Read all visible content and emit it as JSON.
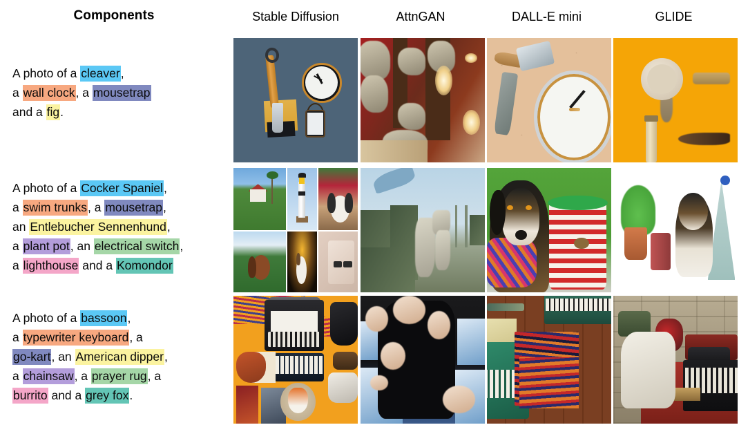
{
  "header": {
    "components_label": "Components",
    "models": [
      "Stable Diffusion",
      "AttnGAN",
      "DALL-E mini",
      "GLIDE"
    ]
  },
  "highlight_colors": {
    "cyan": "#5bc8f5",
    "orange": "#f7a880",
    "blue_violet": "#8089bf",
    "yellow": "#fbf3a0",
    "purple": "#b39ddb",
    "green": "#a5d6a7",
    "pink": "#f4a6c8",
    "teal": "#63c5b5"
  },
  "rows": [
    {
      "prompt_segments": [
        {
          "text": "A photo of a ",
          "color": null
        },
        {
          "text": "cleaver",
          "color": "#5bc8f5"
        },
        {
          "text": ",\n",
          "color": null
        },
        {
          "text": "a ",
          "color": null
        },
        {
          "text": "wall clock",
          "color": "#f7a880"
        },
        {
          "text": ", a ",
          "color": null
        },
        {
          "text": "mousetrap",
          "color": "#8089bf"
        },
        {
          "text": "\nand a ",
          "color": null
        },
        {
          "text": "fig",
          "color": "#fbf3a0"
        },
        {
          "text": ".",
          "color": null
        }
      ],
      "prompt_plain": "A photo of a cleaver, a wall clock, a mousetrap and a fig.",
      "components": [
        "cleaver",
        "wall clock",
        "mousetrap",
        "fig"
      ],
      "images": [
        {
          "model": "Stable Diffusion",
          "description": "cleaver, wall clock and mousetrap arranged on a slate blue background"
        },
        {
          "model": "AttnGAN",
          "description": "distorted beige objects against a red and brown wooden wall"
        },
        {
          "model": "DALL-E mini",
          "description": "two cleavers beside a large wall clock on a speckled beige surface"
        },
        {
          "model": "GLIDE",
          "description": "wall clock and blurred objects on a bright orange wall"
        }
      ]
    },
    {
      "prompt_segments": [
        {
          "text": "A photo of a ",
          "color": null
        },
        {
          "text": "Cocker Spaniel",
          "color": "#5bc8f5"
        },
        {
          "text": ",\n",
          "color": null
        },
        {
          "text": "a ",
          "color": null
        },
        {
          "text": "swim trunks",
          "color": "#f7a880"
        },
        {
          "text": ", a ",
          "color": null
        },
        {
          "text": "mousetrap",
          "color": "#8089bf"
        },
        {
          "text": ",\nan ",
          "color": null
        },
        {
          "text": "Entlebucher Sennenhund",
          "color": "#fbf3a0"
        },
        {
          "text": ",\na ",
          "color": null
        },
        {
          "text": "plant pot",
          "color": "#b39ddb"
        },
        {
          "text": ", an ",
          "color": null
        },
        {
          "text": "electrical switch",
          "color": "#a5d6a7"
        },
        {
          "text": ",\na ",
          "color": null
        },
        {
          "text": "lighthouse",
          "color": "#f4a6c8"
        },
        {
          "text": " and a ",
          "color": null
        },
        {
          "text": "Komondor",
          "color": "#63c5b5"
        }
      ],
      "prompt_plain": "A photo of a Cocker Spaniel, a swim trunks, a mousetrap, an Entlebucher Sennenhund, a plant pot, an electrical switch, a lighthouse and a Komondor",
      "components": [
        "Cocker Spaniel",
        "swim trunks",
        "mousetrap",
        "Entlebucher Sennenhund",
        "plant pot",
        "electrical switch",
        "lighthouse",
        "Komondor"
      ],
      "images": [
        {
          "model": "Stable Diffusion",
          "description": "collage of six photos: house with garden, lighthouse, shaggy dog with red flowers, hound at the beach, dog under a spotlight, and a wall light switch"
        },
        {
          "model": "AttnGAN",
          "description": "washed out green structures and pale figures under a blue sky"
        },
        {
          "model": "DALL-E mini",
          "description": "black and tan dog wearing a patterned coat next to a red and white striped pot on grass"
        },
        {
          "model": "GLIDE",
          "description": "plant in a terracotta pot, a red cylinder and a tricolour dog on white"
        }
      ]
    },
    {
      "prompt_segments": [
        {
          "text": "A photo of a ",
          "color": null
        },
        {
          "text": "bassoon",
          "color": "#5bc8f5"
        },
        {
          "text": ",\n",
          "color": null
        },
        {
          "text": "a ",
          "color": null
        },
        {
          "text": "typewriter keyboard",
          "color": "#f7a880"
        },
        {
          "text": ", a\n",
          "color": null
        },
        {
          "text": "go-kart",
          "color": "#8089bf"
        },
        {
          "text": ", an ",
          "color": null
        },
        {
          "text": "American dipper",
          "color": "#fbf3a0"
        },
        {
          "text": ",\na ",
          "color": null
        },
        {
          "text": "chainsaw",
          "color": "#b39ddb"
        },
        {
          "text": ", a ",
          "color": null
        },
        {
          "text": "prayer rug",
          "color": "#a5d6a7"
        },
        {
          "text": ", a\n",
          "color": null
        },
        {
          "text": "burrito",
          "color": "#f4a6c8"
        },
        {
          "text": " and a ",
          "color": null
        },
        {
          "text": "grey fox",
          "color": "#63c5b5"
        },
        {
          "text": ".",
          "color": null
        }
      ],
      "prompt_plain": "A photo of a bassoon, a typewriter keyboard, a go-kart, an American dipper, a chainsaw, a prayer rug, a burrito and a grey fox.",
      "components": [
        "bassoon",
        "typewriter keyboard",
        "go-kart",
        "American dipper",
        "chainsaw",
        "prayer rug",
        "burrito",
        "grey fox"
      ],
      "images": [
        {
          "model": "Stable Diffusion",
          "description": "orange background collage of typewriters, keyboards, bags, a log, a vacuum and two foxes"
        },
        {
          "model": "AttnGAN",
          "description": "blurred dark figure with pale hands over blue boxes"
        },
        {
          "model": "DALL-E mini",
          "description": "green typewriters and a striped woven rug on a wooden floor"
        },
        {
          "model": "GLIDE",
          "description": "white crumpled object and a red typewriter against a brick wall"
        }
      ]
    }
  ]
}
